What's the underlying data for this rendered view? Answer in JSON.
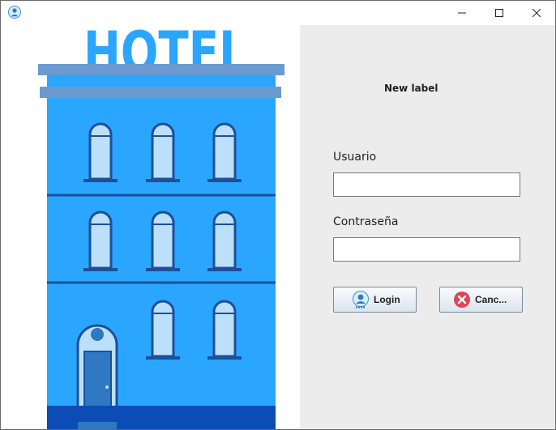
{
  "window": {
    "icon": "user-icon",
    "controls": {
      "minimize": "minimize-icon",
      "maximize": "maximize-icon",
      "close": "close-icon"
    }
  },
  "hero": {
    "sign_text": "HOTEL",
    "colors": {
      "building": "#2ba6ff",
      "sign": "#2ba6ff",
      "roof": "#6b9ad0",
      "window_frame": "#1d4f9a",
      "window_glass": "#bde0fa",
      "base": "#0b4db5"
    }
  },
  "form": {
    "title": "New label",
    "usuario_label": "Usuario",
    "usuario_value": "",
    "password_label": "Contraseña",
    "password_value": "",
    "login_label": "Login",
    "login_icon": "user-icon",
    "cancel_label": "Canc...",
    "cancel_icon": "cancel-icon"
  }
}
